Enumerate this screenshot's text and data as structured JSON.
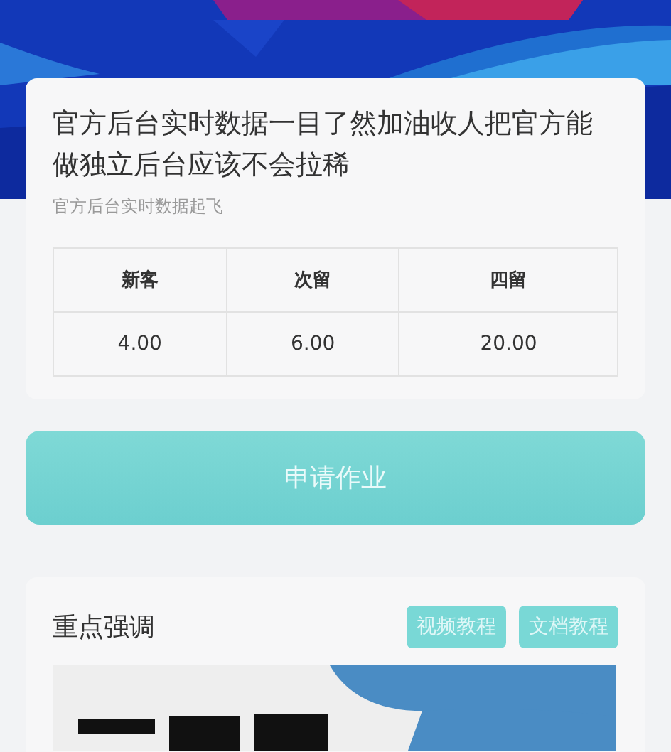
{
  "headline": "官方后台实时数据一目了然加油收人把官方能做独立后台应该不会拉稀",
  "subtitle": "官方后台实时数据起飞",
  "table": {
    "columns": [
      "新客",
      "次留",
      "四留"
    ],
    "rows": [
      [
        "4.00",
        "6.00",
        "20.00"
      ]
    ]
  },
  "apply_button": "申请作业",
  "highlights": {
    "title": "重点强调",
    "tags": [
      "视频教程",
      "文档教程"
    ],
    "image": {
      "kind": "picture"
    }
  }
}
